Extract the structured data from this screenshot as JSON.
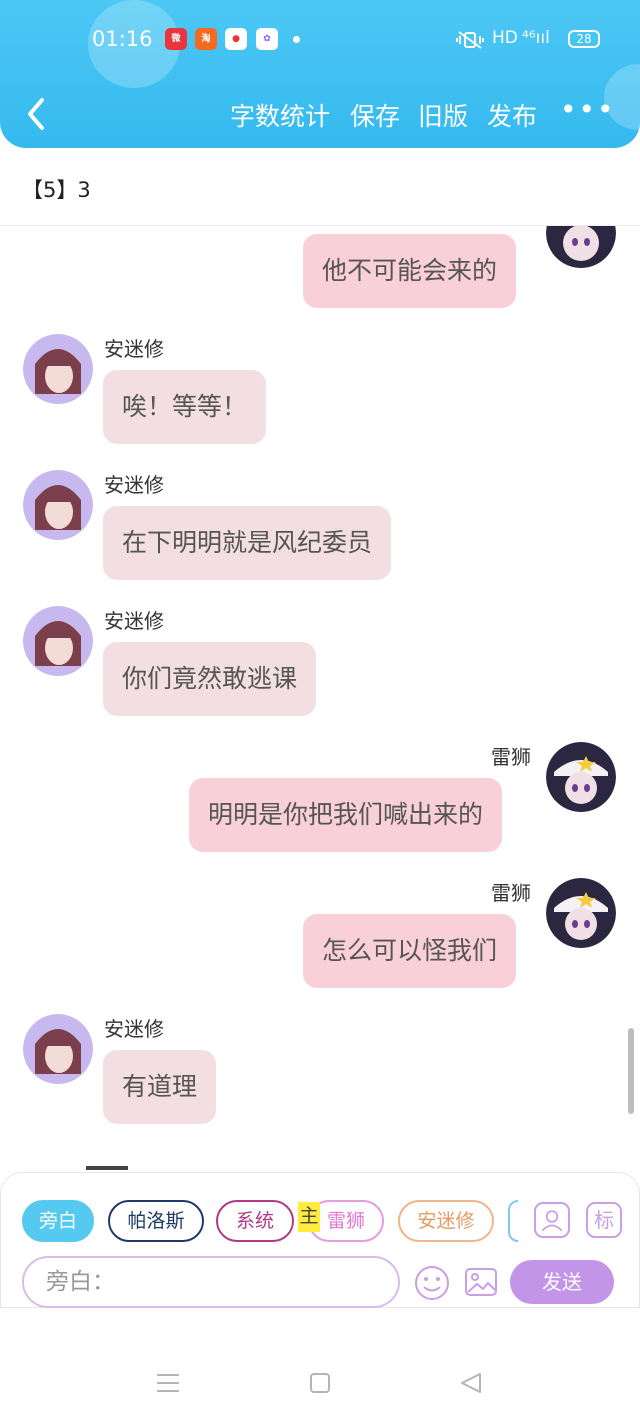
{
  "status_bar": {
    "time": "01:16",
    "app_icons": [
      "weibo-icon",
      "taobao-icon",
      "music-icon",
      "photo-icon"
    ],
    "network": "HD",
    "signal": "⁴⁶ııl",
    "battery": "28"
  },
  "header": {
    "back_icon": "chevron-left-icon",
    "actions": {
      "word_count": "字数统计",
      "save": "保存",
      "old_version": "旧版",
      "publish": "发布",
      "more": "•••"
    }
  },
  "title": "【5】3",
  "messages": [
    {
      "side": "right",
      "speaker": "",
      "text": "他不可能会来的"
    },
    {
      "side": "left",
      "speaker": "安迷修",
      "text": "唉！等等！"
    },
    {
      "side": "left",
      "speaker": "安迷修",
      "text": "在下明明就是风纪委员"
    },
    {
      "side": "left",
      "speaker": "安迷修",
      "text": "你们竟然敢逃课"
    },
    {
      "side": "right",
      "speaker": "雷狮",
      "text": "明明是你把我们喊出来的"
    },
    {
      "side": "right",
      "speaker": "雷狮",
      "text": "怎么可以怪我们"
    },
    {
      "side": "left",
      "speaker": "安迷修",
      "text": "有道理"
    }
  ],
  "roles": [
    "旁白",
    "帕洛斯",
    "系统",
    "雷狮",
    "安迷修"
  ],
  "role_marker": "主",
  "tools": {
    "character_icon": "person-card-icon",
    "tag_label": "标"
  },
  "input": {
    "placeholder": "旁白："
  },
  "send_label": "发送",
  "colors": {
    "header": "#4cc8f5",
    "bubble_left": "#f3dfe1",
    "bubble_right": "#f9cfd8",
    "send": "#c395e9"
  }
}
